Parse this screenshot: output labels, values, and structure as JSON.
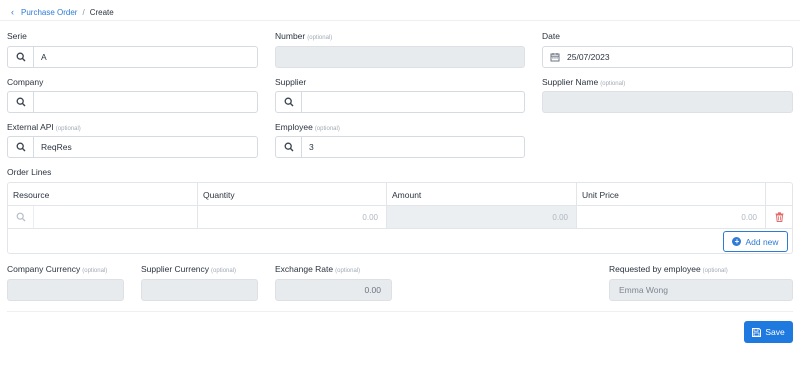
{
  "breadcrumb": {
    "parent": "Purchase Order",
    "separator": "/",
    "current": "Create"
  },
  "form": {
    "serie": {
      "label": "Serie",
      "value": "A"
    },
    "number": {
      "label": "Number",
      "optional": "(optional)",
      "value": ""
    },
    "date": {
      "label": "Date",
      "value": "25/07/2023"
    },
    "company": {
      "label": "Company",
      "value": ""
    },
    "supplier": {
      "label": "Supplier",
      "value": ""
    },
    "supplier_name": {
      "label": "Supplier Name",
      "optional": "(optional)",
      "value": ""
    },
    "external_api": {
      "label": "External API",
      "optional": "(optional)",
      "value": "ReqRes"
    },
    "employee": {
      "label": "Employee",
      "optional": "(optional)",
      "value": "3"
    }
  },
  "order_lines": {
    "title": "Order Lines",
    "columns": [
      "Resource",
      "Quantity",
      "Amount",
      "Unit Price"
    ],
    "rows": [
      {
        "resource": "",
        "quantity": "0.00",
        "amount": "0.00",
        "unit_price": "0.00"
      }
    ],
    "add_new_label": "Add new"
  },
  "footer_fields": {
    "company_currency": {
      "label": "Company Currency",
      "optional": "(optional)",
      "value": ""
    },
    "supplier_currency": {
      "label": "Supplier Currency",
      "optional": "(optional)",
      "value": ""
    },
    "exchange_rate": {
      "label": "Exchange Rate",
      "optional": "(optional)",
      "value": "0.00"
    },
    "requested_by": {
      "label": "Requested by employee",
      "optional": "(optional)",
      "value": "Emma Wong"
    }
  },
  "actions": {
    "save_label": "Save"
  },
  "colors": {
    "accent": "#1f7ae0",
    "link": "#2e7bd6",
    "delete": "#e06b6b",
    "disabled_bg": "#e8ebee"
  },
  "icons": [
    "chevron-left-icon",
    "search-icon",
    "calendar-icon",
    "trash-icon",
    "plus-circle-icon",
    "save-icon"
  ]
}
